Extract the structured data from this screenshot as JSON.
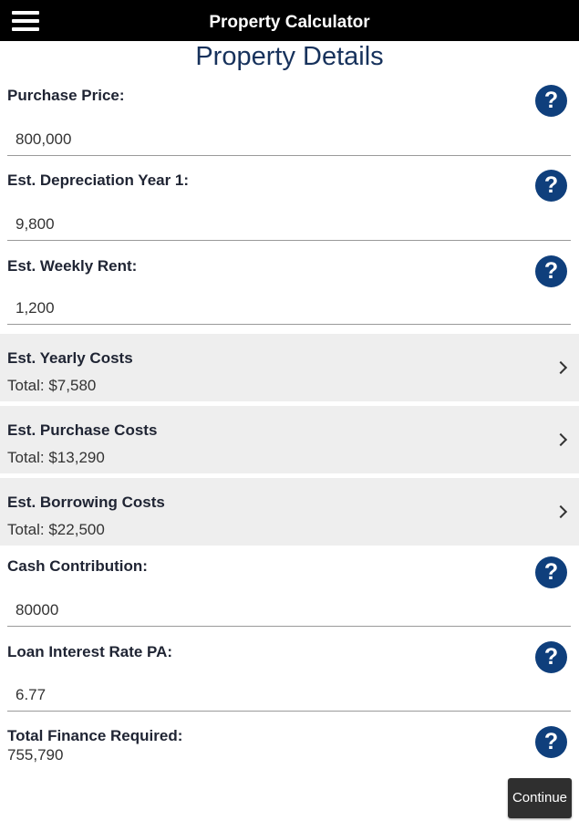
{
  "header": {
    "title": "Property Calculator",
    "menu_icon": "hamburger-menu-icon",
    "background": "#000000"
  },
  "page_title": "Property Details",
  "fields": {
    "purchase_price": {
      "label": "Purchase Price:",
      "value": "800,000"
    },
    "depreciation": {
      "label": "Est. Depreciation Year 1:",
      "value": "9,800"
    },
    "weekly_rent": {
      "label": "Est. Weekly Rent:",
      "value": "1,200"
    },
    "cash_contribution": {
      "label": "Cash Contribution:",
      "value": "80000"
    },
    "interest_rate": {
      "label": "Loan Interest Rate PA:",
      "value": "6.77"
    }
  },
  "help_icon_glyph": "?",
  "nav_rows": [
    {
      "title": "Est. Yearly Costs",
      "total": "Total: $7,580"
    },
    {
      "title": "Est. Purchase Costs",
      "total": "Total: $13,290"
    },
    {
      "title": "Est. Borrowing Costs",
      "total": "Total: $22,500"
    }
  ],
  "total_finance": {
    "label": "Total Finance Required:",
    "value": "755,790"
  },
  "continue_label": "Continue",
  "colors": {
    "title": "#17325c",
    "help_icon": "#0f3f7c",
    "nav_row_bg": "#eeeeee",
    "button_bg": "#2f2f2f"
  }
}
